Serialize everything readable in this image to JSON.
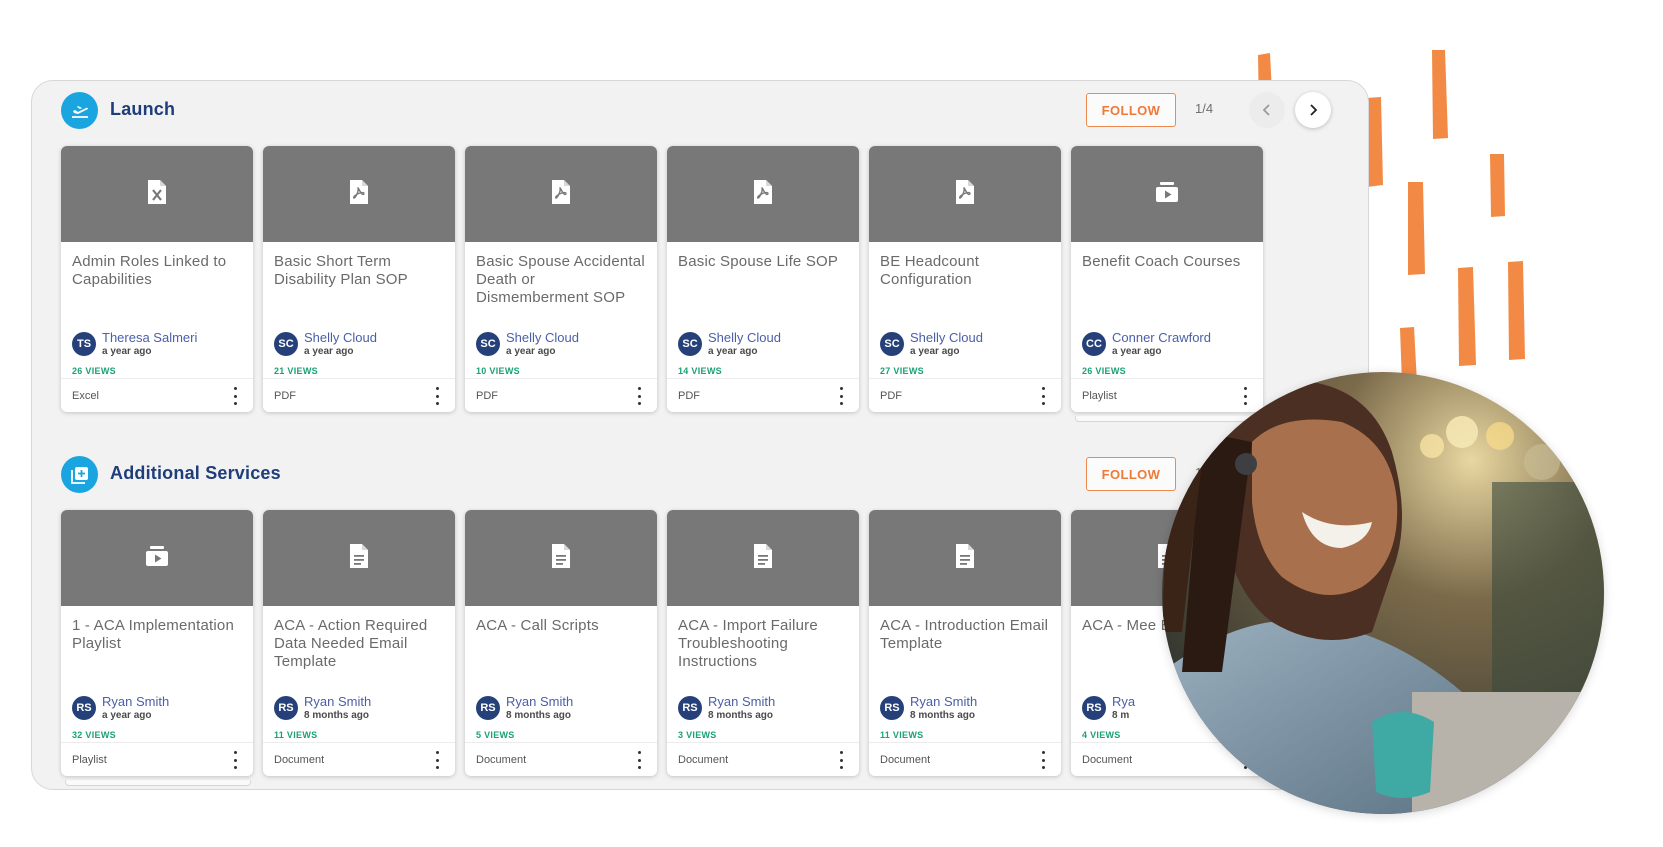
{
  "colors": {
    "accent_blue": "#1ba5e0",
    "title_navy": "#1f3d7a",
    "follow_orange": "#ee7a3a",
    "views_green": "#1aa177",
    "thumb_gray": "#787878",
    "deco_orange": "#f28a45"
  },
  "sections": [
    {
      "title": "Launch",
      "icon": "airplane-takeoff-icon",
      "follow_label": "FOLLOW",
      "pager": "1/4",
      "cards": [
        {
          "icon": "excel-file-icon",
          "title": "Admin Roles Linked to Capabilities",
          "initials": "TS",
          "author": "Theresa Salmeri",
          "time": "a year ago",
          "views": "26 VIEWS",
          "type": "Excel"
        },
        {
          "icon": "pdf-file-icon",
          "title": "Basic Short Term Disability Plan SOP",
          "initials": "SC",
          "author": "Shelly Cloud",
          "time": "a year ago",
          "views": "21 VIEWS",
          "type": "PDF"
        },
        {
          "icon": "pdf-file-icon",
          "title": "Basic Spouse Accidental Death or Dismemberment SOP",
          "initials": "SC",
          "author": "Shelly Cloud",
          "time": "a year ago",
          "views": "10 VIEWS",
          "type": "PDF"
        },
        {
          "icon": "pdf-file-icon",
          "title": "Basic Spouse Life SOP",
          "initials": "SC",
          "author": "Shelly Cloud",
          "time": "a year ago",
          "views": "14 VIEWS",
          "type": "PDF"
        },
        {
          "icon": "pdf-file-icon",
          "title": "BE Headcount Configuration",
          "initials": "SC",
          "author": "Shelly Cloud",
          "time": "a year ago",
          "views": "27 VIEWS",
          "type": "PDF"
        },
        {
          "icon": "playlist-icon",
          "title": "Benefit Coach Courses",
          "initials": "CC",
          "author": "Conner Crawford",
          "time": "a year ago",
          "views": "26 VIEWS",
          "type": "Playlist"
        }
      ]
    },
    {
      "title": "Additional Services",
      "icon": "add-library-icon",
      "follow_label": "FOLLOW",
      "pager": "1/",
      "cards": [
        {
          "icon": "playlist-icon",
          "title": "1 - ACA Implementation Playlist",
          "initials": "RS",
          "author": "Ryan Smith",
          "time": "a year ago",
          "views": "32 VIEWS",
          "type": "Playlist"
        },
        {
          "icon": "document-icon",
          "title": "ACA - Action Required Data Needed Email Template",
          "initials": "RS",
          "author": "Ryan Smith",
          "time": "8 months ago",
          "views": "11 VIEWS",
          "type": "Document"
        },
        {
          "icon": "document-icon",
          "title": "ACA - Call Scripts",
          "initials": "RS",
          "author": "Ryan Smith",
          "time": "8 months ago",
          "views": "5 VIEWS",
          "type": "Document"
        },
        {
          "icon": "document-icon",
          "title": "ACA - Import Failure Troubleshooting Instructions",
          "initials": "RS",
          "author": "Ryan Smith",
          "time": "8 months ago",
          "views": "3 VIEWS",
          "type": "Document"
        },
        {
          "icon": "document-icon",
          "title": "ACA - Introduction Email Template",
          "initials": "RS",
          "author": "Ryan Smith",
          "time": "8 months ago",
          "views": "11 VIEWS",
          "type": "Document"
        },
        {
          "icon": "document-icon",
          "title": "ACA - Mee Ema",
          "initials": "RS",
          "author": "Rya",
          "time": "8 m",
          "views": "4 VIEWS",
          "type": "Document"
        }
      ]
    }
  ],
  "photo": {
    "icon": "smiling-woman-photo"
  }
}
